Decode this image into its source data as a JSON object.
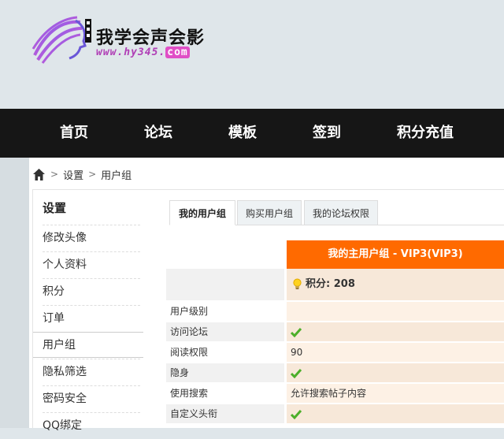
{
  "logo": {
    "title": "我学会声会影",
    "url_main": "www.hy345.",
    "url_tld": "com"
  },
  "nav": [
    {
      "label": "首页"
    },
    {
      "label": "论坛"
    },
    {
      "label": "模板"
    },
    {
      "label": "签到"
    },
    {
      "label": "积分充值"
    }
  ],
  "breadcrumb": {
    "items": [
      "设置",
      "用户组"
    ]
  },
  "sidebar": {
    "title": "设置",
    "items": [
      {
        "label": "修改头像"
      },
      {
        "label": "个人资料"
      },
      {
        "label": "积分"
      },
      {
        "label": "订单"
      },
      {
        "label": "用户组",
        "active": true
      },
      {
        "label": "隐私筛选"
      },
      {
        "label": "密码安全"
      },
      {
        "label": "QQ绑定"
      }
    ]
  },
  "tabs": [
    {
      "label": "我的用户组",
      "active": true
    },
    {
      "label": "购买用户组"
    },
    {
      "label": "我的论坛权限"
    }
  ],
  "group": {
    "header": "我的主用户组 - VIP3(VIP3)",
    "credit": "积分: 208",
    "rows": [
      {
        "label": "用户级别",
        "value": ""
      },
      {
        "label": "访问论坛",
        "value": "",
        "check": true
      },
      {
        "label": "阅读权限",
        "value": "90"
      },
      {
        "label": "隐身",
        "value": "",
        "check": true
      },
      {
        "label": "使用搜索",
        "value": "允许搜索帖子内容"
      },
      {
        "label": "自定义头衔",
        "value": "",
        "check": true
      }
    ]
  },
  "colors": {
    "accent": "#ff6a00",
    "nav_bg": "#161616",
    "check": "#4caf2a"
  }
}
